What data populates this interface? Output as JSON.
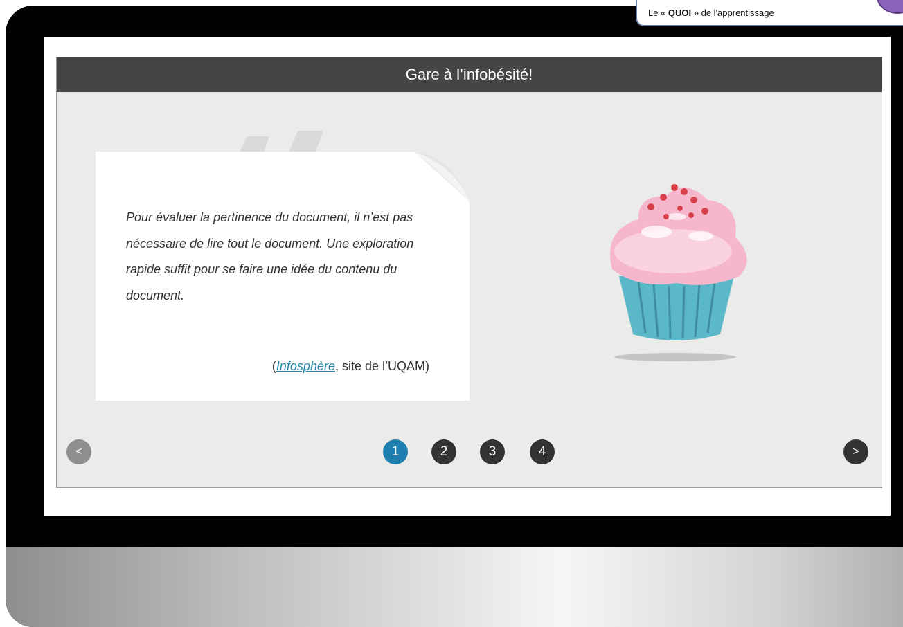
{
  "header_badge": {
    "text_prefix": "Le « ",
    "text_bold": "QUOI",
    "text_suffix": " » de l'apprentissage"
  },
  "slider": {
    "title": "Gare à l’infobésité!",
    "card": {
      "text": "Pour évaluer la pertinence du document, il n’est pas nécessaire de lire tout le document. Une exploration rapide suffit pour se faire une idée du contenu du document.",
      "cite_open": "(",
      "cite_link": "Infosphère",
      "cite_rest": ", site de l’UQAM)"
    },
    "nav": {
      "prev_label": "<",
      "next_label": ">"
    },
    "pages": [
      "1",
      "2",
      "3",
      "4"
    ],
    "current_page": "1"
  },
  "colors": {
    "header_bg": "#454545",
    "active_dot": "#1c7fb0",
    "link": "#1e88a8",
    "slide_bg": "#ebebe9"
  }
}
